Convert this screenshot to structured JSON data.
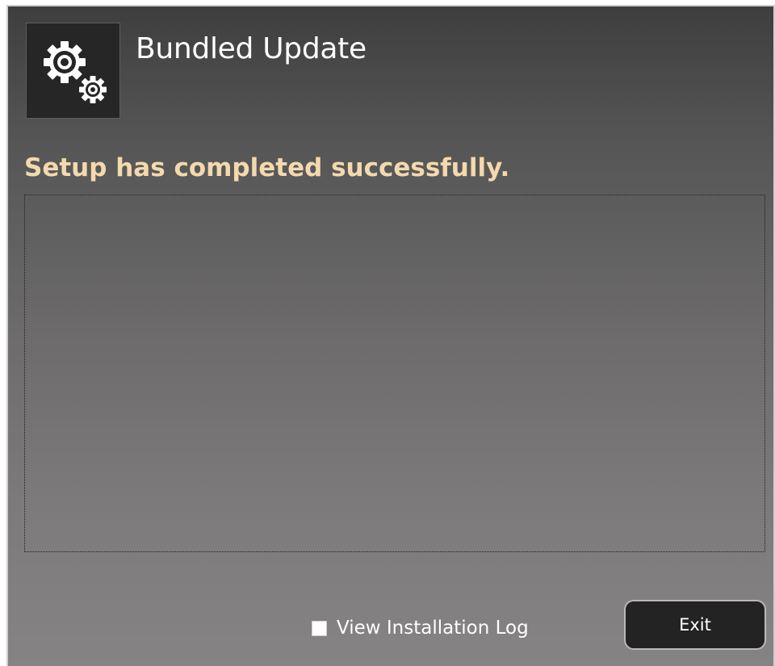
{
  "window": {
    "title": "Bundled Update",
    "app_icon": "gears-icon"
  },
  "status": {
    "message": "Setup has completed successfully."
  },
  "footer": {
    "view_log_label": "View Installation Log",
    "view_log_checked": false,
    "exit_label": "Exit"
  },
  "colors": {
    "status_text": "#f3d9ad",
    "title_text": "#ffffff",
    "button_bg": "#232323"
  }
}
